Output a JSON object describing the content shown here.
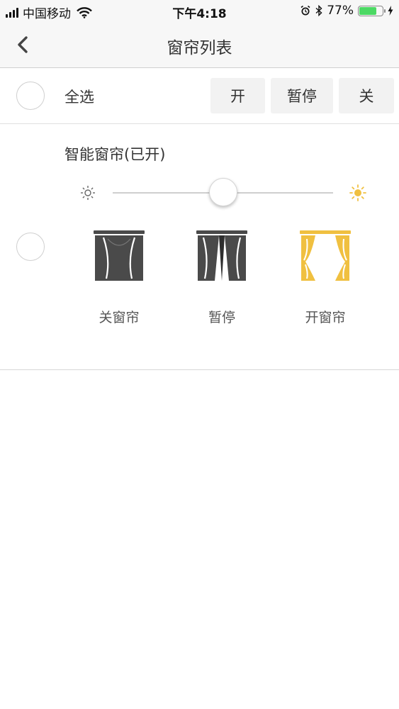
{
  "status_bar": {
    "carrier": "中国移动",
    "time": "下午4:18",
    "battery_percent": "77%",
    "battery_level": 0.77,
    "signal_bars": 4,
    "icons": [
      "signal-icon",
      "wifi-icon",
      "alarm-icon",
      "bluetooth-icon",
      "battery-icon",
      "charging-icon"
    ]
  },
  "nav": {
    "title": "窗帘列表",
    "back_icon": "chevron-left-icon"
  },
  "select_all": {
    "label": "全选",
    "buttons": {
      "open": "开",
      "pause": "暂停",
      "close": "关"
    }
  },
  "device": {
    "name": "智能窗帘(已开)",
    "brightness_fraction": 0.5,
    "slider_icons": {
      "low": "sun-outline-icon",
      "high": "sun-filled-icon"
    },
    "controls": {
      "close_label": "关窗帘",
      "pause_label": "暂停",
      "open_label": "开窗帘"
    }
  },
  "colors": {
    "accent_yellow": "#f0c040",
    "curtain_dark": "#4a4a4a",
    "battery_green": "#4cd964"
  }
}
